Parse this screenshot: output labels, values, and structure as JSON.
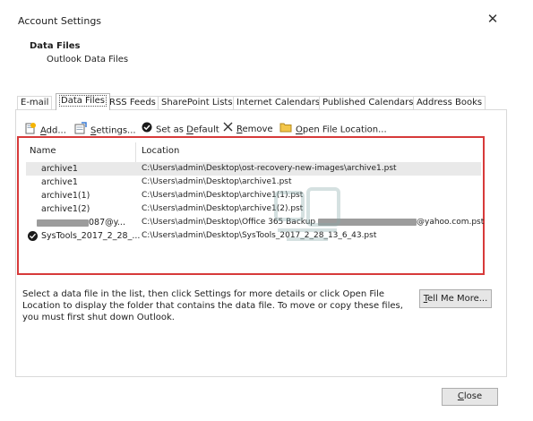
{
  "window": {
    "title": "Account Settings",
    "close_glyph": "✕"
  },
  "header": {
    "title": "Data Files",
    "subtitle": "Outlook Data Files"
  },
  "tabs": [
    {
      "label": "E-mail",
      "active": false
    },
    {
      "label": "Data Files",
      "active": true
    },
    {
      "label": "RSS Feeds",
      "active": false
    },
    {
      "label": "SharePoint Lists",
      "active": false
    },
    {
      "label": "Internet Calendars",
      "active": false
    },
    {
      "label": "Published Calendars",
      "active": false
    },
    {
      "label": "Address Books",
      "active": false
    }
  ],
  "toolbar": {
    "add": {
      "icon": "add-data-file-icon",
      "pre": "",
      "key": "A",
      "post": "dd..."
    },
    "settings": {
      "icon": "settings-icon",
      "pre": "",
      "key": "S",
      "post": "ettings..."
    },
    "set_default": {
      "icon": "checkmark-circle-icon",
      "pre": "Set as ",
      "key": "D",
      "post": "efault"
    },
    "remove": {
      "icon": "remove-x-icon",
      "pre": "",
      "key": "R",
      "post": "emove"
    },
    "open_location": {
      "icon": "folder-icon",
      "pre": "",
      "key": "O",
      "post": "pen File Location..."
    }
  },
  "table": {
    "columns": [
      "Name",
      "Location"
    ],
    "rows": [
      {
        "name": "archive1",
        "location": "C:\\Users\\admin\\Desktop\\ost-recovery-new-images\\archive1.pst",
        "selected": true,
        "default": false
      },
      {
        "name": "archive1",
        "location": "C:\\Users\\admin\\Desktop\\archive1.pst",
        "selected": false,
        "default": false
      },
      {
        "name": "archive1(1)",
        "location": "C:\\Users\\admin\\Desktop\\archive1(1).pst",
        "selected": false,
        "default": false
      },
      {
        "name": "archive1(2)",
        "location": "C:\\Users\\admin\\Desktop\\archive1(2).pst",
        "selected": false,
        "default": false
      },
      {
        "name": "087@y...",
        "location": "C:\\Users\\admin\\Desktop\\Office 365 Backup",
        "location_suffix": "@yahoo.com.pst",
        "selected": false,
        "default": false,
        "redacted": true
      },
      {
        "name": "SysTools_2017_2_28_...",
        "location": "C:\\Users\\admin\\Desktop\\SysTools_2017_2_28_13_6_43.pst",
        "selected": false,
        "default": true
      }
    ]
  },
  "help_text": "Select a data file in the list, then click Settings for more details or click Open File Location to display the folder that contains the data file. To move or copy these files, you must first shut down Outlook.",
  "buttons": {
    "tell_me": {
      "key": "T",
      "post": "ell Me More..."
    },
    "close": {
      "key": "C",
      "post": "lose"
    }
  },
  "colors": {
    "highlight_outline": "#d73a3a",
    "selected_row": "#e9e9e9",
    "button_face": "#e6e6e6"
  }
}
